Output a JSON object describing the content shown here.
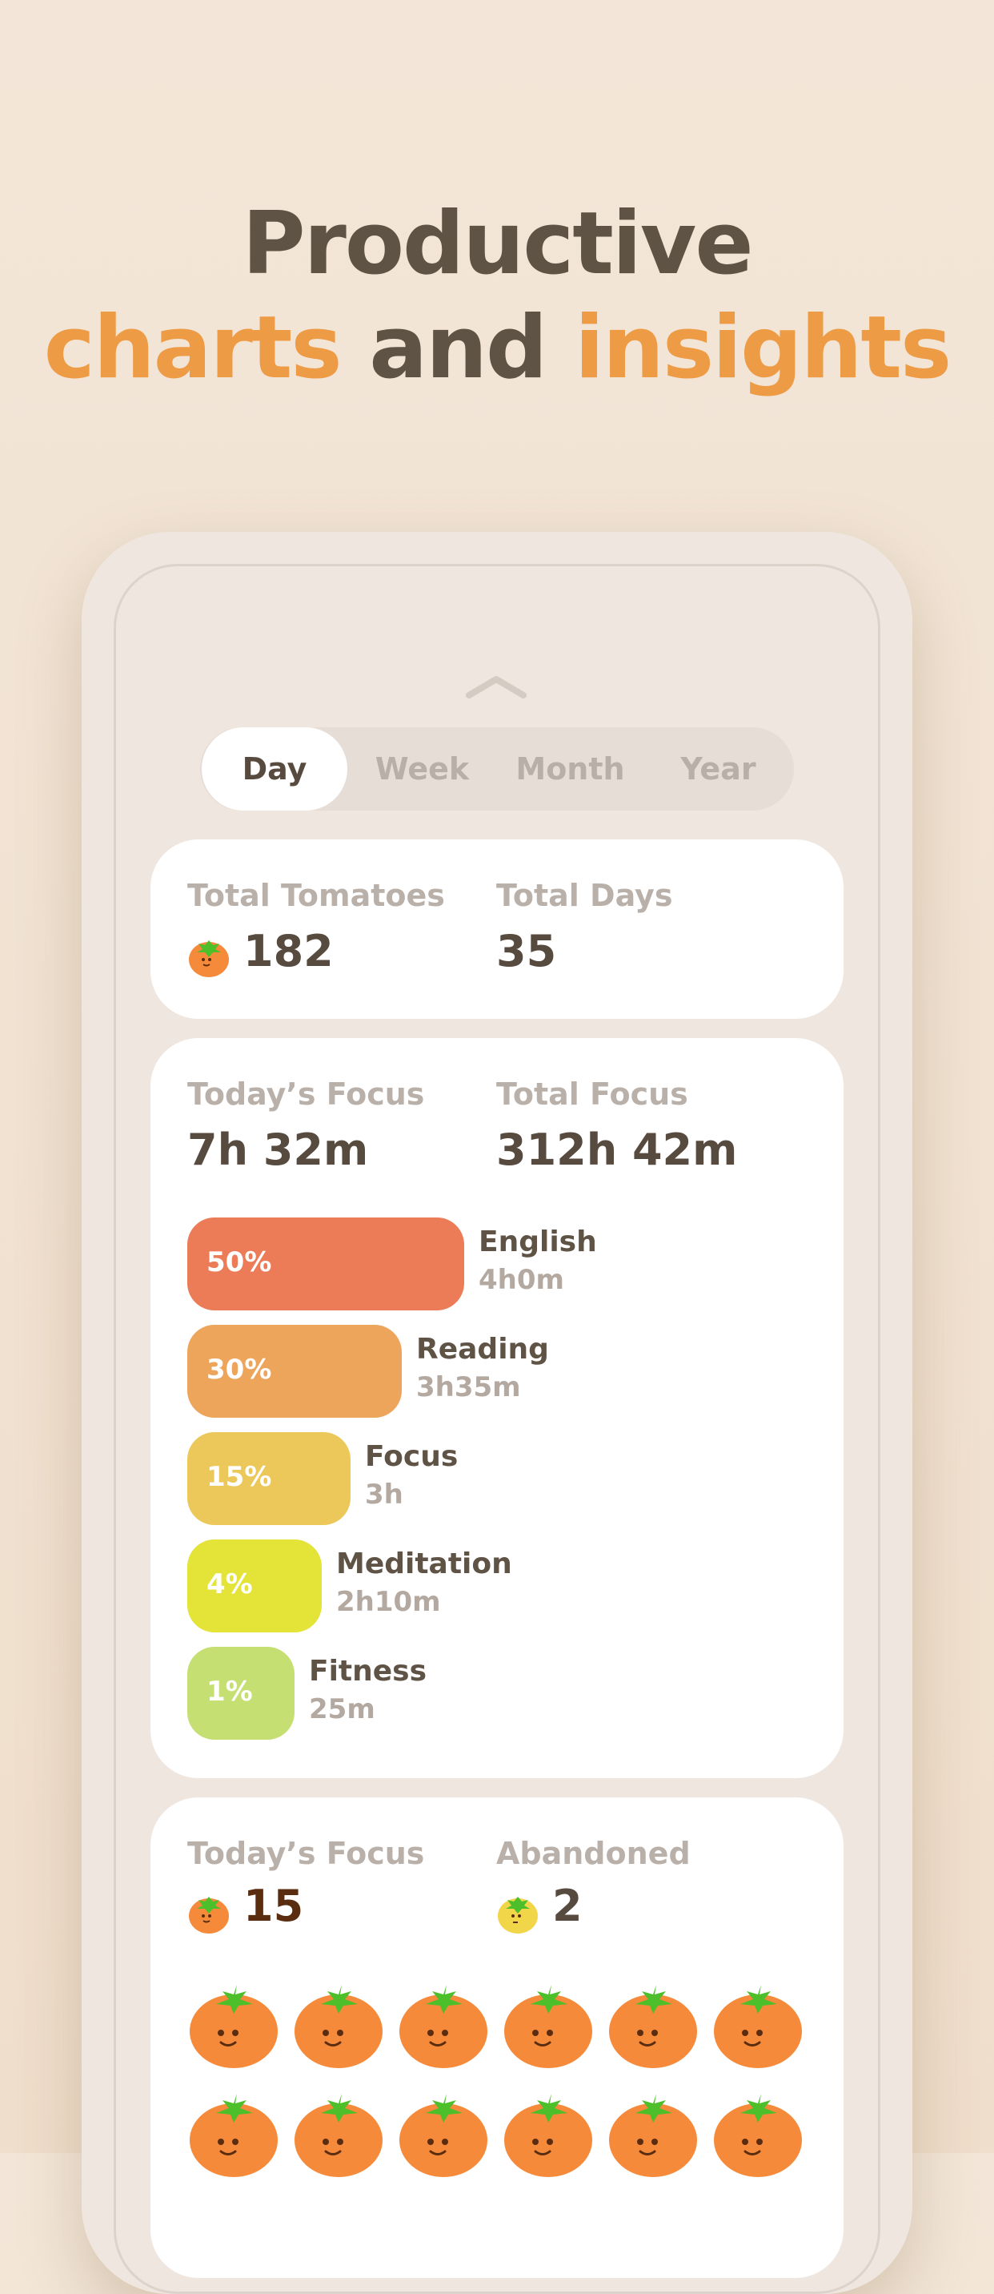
{
  "headline": {
    "line1": "Productive",
    "line2_a": "charts",
    "line2_b": "and",
    "line2_c": "insights"
  },
  "tabs": [
    {
      "label": "Day",
      "active": true
    },
    {
      "label": "Week",
      "active": false
    },
    {
      "label": "Month",
      "active": false
    },
    {
      "label": "Year",
      "active": false
    }
  ],
  "summary": {
    "total_tomatoes_label": "Total Tomatoes",
    "total_tomatoes_value": "182",
    "total_days_label": "Total Days",
    "total_days_value": "35"
  },
  "focus": {
    "today_label": "Today’s Focus",
    "today_value": "7h 32m",
    "total_label": "Total Focus",
    "total_value": "312h 42m",
    "categories": [
      {
        "pct_label": "50%",
        "percent": 50,
        "name": "English",
        "time": "4h0m",
        "color": "#ec7b58"
      },
      {
        "pct_label": "30%",
        "percent": 30,
        "name": "Reading",
        "time": "3h35m",
        "color": "#eda45b"
      },
      {
        "pct_label": "15%",
        "percent": 15,
        "name": "Focus",
        "time": "3h",
        "color": "#ecc85a"
      },
      {
        "pct_label": "4%",
        "percent": 4,
        "name": "Meditation",
        "time": "2h10m",
        "color": "#e3e338"
      },
      {
        "pct_label": "1%",
        "percent": 1,
        "name": "Fitness",
        "time": "25m",
        "color": "#c6df72"
      }
    ]
  },
  "tomato_stats": {
    "today_label": "Today’s Focus",
    "today_value": "15",
    "abandoned_label": "Abandoned",
    "abandoned_value": "2"
  },
  "colors": {
    "accent": "#ee9b45",
    "text_dark": "#574a3e",
    "tomato": "#f58a3a",
    "tomato_leaf": "#4cbf2a",
    "abandoned_tomato": "#f2d64a"
  }
}
